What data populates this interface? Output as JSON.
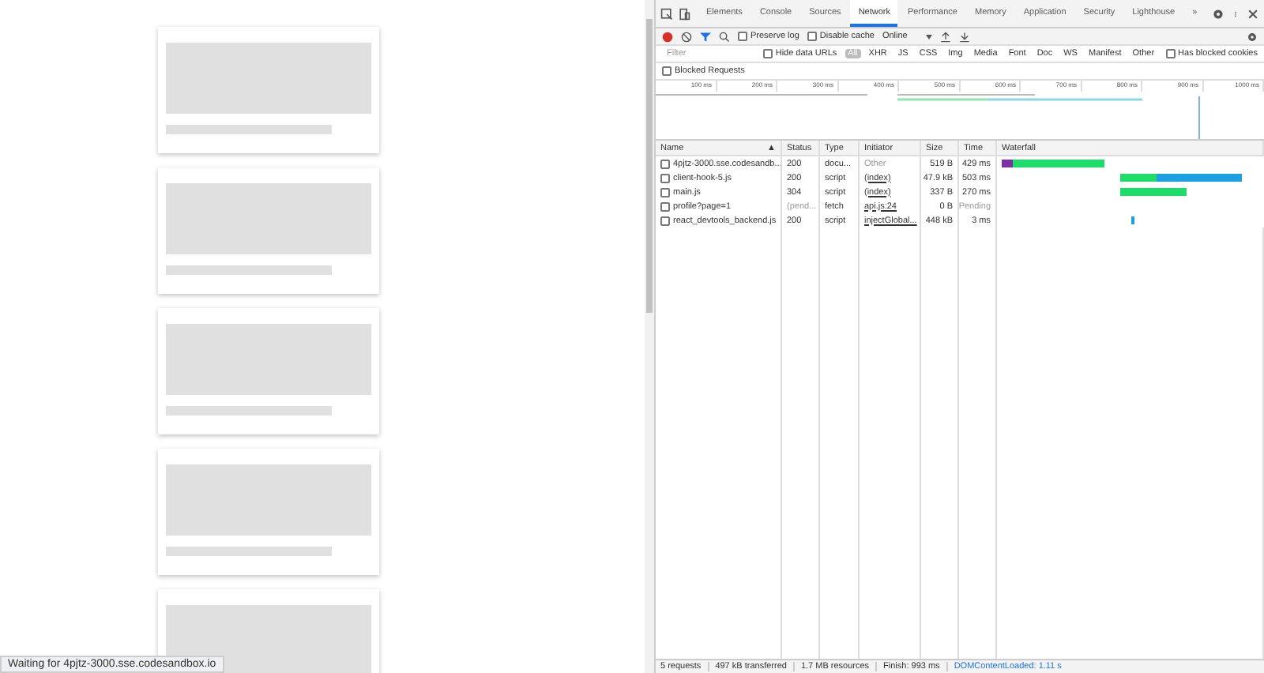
{
  "page": {
    "cards": [
      {
        "kind": "skeleton"
      },
      {
        "kind": "skeleton"
      },
      {
        "kind": "skeleton"
      },
      {
        "kind": "skeleton"
      },
      {
        "kind": "skeleton_cut"
      }
    ],
    "status_text": "Waiting for 4pjtz-3000.sse.codesandbox.io"
  },
  "devtools": {
    "tabs": [
      {
        "label": "Elements",
        "selected": false
      },
      {
        "label": "Console",
        "selected": false
      },
      {
        "label": "Sources",
        "selected": false
      },
      {
        "label": "Network",
        "selected": true
      },
      {
        "label": "Performance",
        "selected": false
      },
      {
        "label": "Memory",
        "selected": false
      },
      {
        "label": "Application",
        "selected": false
      },
      {
        "label": "Security",
        "selected": false
      },
      {
        "label": "Lighthouse",
        "selected": false
      }
    ],
    "more_tabs": "»",
    "toolbar": {
      "recording": true,
      "filter_on": true,
      "preserve_log": {
        "label": "Preserve log",
        "checked": false
      },
      "disable_cache": {
        "label": "Disable cache",
        "checked": false
      },
      "throttling": "Online"
    },
    "filter": {
      "placeholder": "Filter",
      "hide_data_urls": {
        "label": "Hide data URLs",
        "checked": false
      },
      "types": [
        {
          "label": "All",
          "selected": true
        },
        {
          "label": "XHR",
          "selected": false
        },
        {
          "label": "JS",
          "selected": false
        },
        {
          "label": "CSS",
          "selected": false
        },
        {
          "label": "Img",
          "selected": false
        },
        {
          "label": "Media",
          "selected": false
        },
        {
          "label": "Font",
          "selected": false
        },
        {
          "label": "Doc",
          "selected": false
        },
        {
          "label": "WS",
          "selected": false
        },
        {
          "label": "Manifest",
          "selected": false
        },
        {
          "label": "Other",
          "selected": false
        }
      ],
      "has_blocked_cookies": {
        "label": "Has blocked cookies",
        "checked": false
      },
      "blocked_requests": {
        "label": "Blocked Requests",
        "checked": false
      }
    },
    "overview_ticks": [
      "100 ms",
      "200 ms",
      "300 ms",
      "400 ms",
      "500 ms",
      "600 ms",
      "700 ms",
      "800 ms",
      "900 ms",
      "1000 ms"
    ],
    "columns": [
      "Name",
      "Status",
      "Type",
      "Initiator",
      "Size",
      "Time",
      "Waterfall"
    ],
    "sort_arrow": "▲",
    "rows": [
      {
        "name": "4pjtz-3000.sse.codesandb...",
        "status": "200",
        "type": "docu...",
        "initiator": "Other",
        "initiator_link": false,
        "size": "519 B",
        "time": "429 ms",
        "pending": false
      },
      {
        "name": "client-hook-5.js",
        "status": "200",
        "type": "script",
        "initiator": "(index)",
        "initiator_link": true,
        "size": "47.9 kB",
        "time": "503 ms",
        "pending": false
      },
      {
        "name": "main.js",
        "status": "304",
        "type": "script",
        "initiator": "(index)",
        "initiator_link": true,
        "size": "337 B",
        "time": "270 ms",
        "pending": false
      },
      {
        "name": "profile?page=1",
        "status": "(pend...",
        "type": "fetch",
        "initiator": "api.js:24",
        "initiator_link": true,
        "size": "0 B",
        "time": "Pending",
        "pending": true
      },
      {
        "name": "react_devtools_backend.js",
        "status": "200",
        "type": "script",
        "initiator": "injectGlobal...",
        "initiator_link": true,
        "size": "448 kB",
        "time": "3 ms",
        "pending": false
      }
    ],
    "summary": [
      "5 requests",
      "497 kB transferred",
      "1.7 MB resources",
      "Finish: 993 ms"
    ],
    "dom_loaded": "DOMContentLoaded: 1.11 s"
  }
}
